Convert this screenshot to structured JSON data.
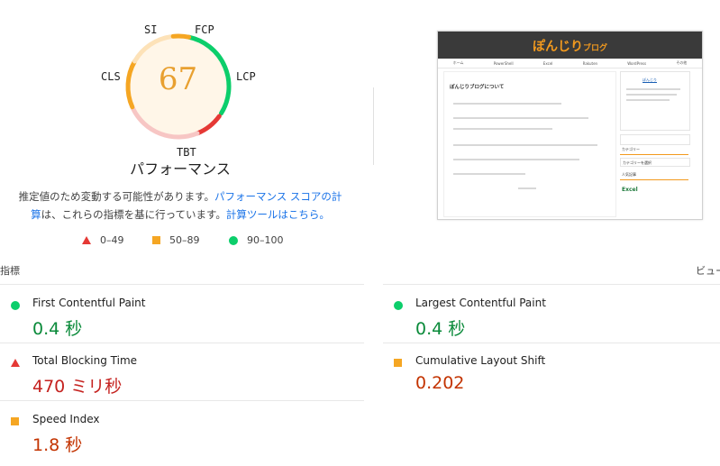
{
  "gauge": {
    "score": "67",
    "labels": {
      "si": "SI",
      "fcp": "FCP",
      "lcp": "LCP",
      "tbt": "TBT",
      "cls": "CLS"
    },
    "title": "パフォーマンス",
    "colors": {
      "green": "#0cce6b",
      "orange": "#f5a623",
      "red": "#e53935",
      "score_text": "#e8a030"
    }
  },
  "description": {
    "text1": "推定値のため変動する可能性があります。",
    "link1": "パフォーマンス スコアの計算",
    "text2": "は、これらの指標を基に行っています。",
    "link2": "計算ツールはこちら。"
  },
  "legend": {
    "fail": "0–49",
    "average": "50–89",
    "pass": "90–100"
  },
  "thumbnail": {
    "logo_main": "ぽんじり",
    "logo_sub": "ブログ",
    "nav": [
      "ホーム",
      "PowerShell",
      "Excel",
      "Rakuten",
      "WordPress",
      "その他"
    ],
    "post_title": "ぽんじりブログについて",
    "sidebar": [
      "ぽんじり",
      "カテゴリー",
      "カテゴリーを選択",
      "人気記事",
      "Excel"
    ]
  },
  "metrics": {
    "header": "指標",
    "view_label": "ビューを",
    "items": [
      {
        "name": "First Contentful Paint",
        "value": "0.4 秒",
        "status": "pass"
      },
      {
        "name": "Largest Contentful Paint",
        "value": "0.4 秒",
        "status": "pass"
      },
      {
        "name": "Total Blocking Time",
        "value": "470 ミリ秒",
        "status": "fail"
      },
      {
        "name": "Cumulative Layout Shift",
        "value": "0.202",
        "status": "average"
      },
      {
        "name": "Speed Index",
        "value": "1.8 秒",
        "status": "average"
      }
    ]
  }
}
